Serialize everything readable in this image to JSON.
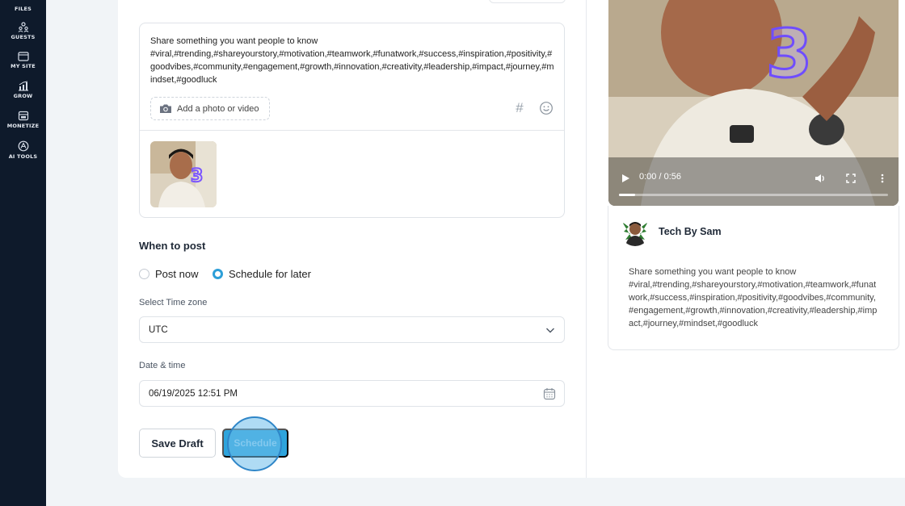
{
  "sidebar": {
    "items": [
      {
        "label": "FILES",
        "icon": "files-icon"
      },
      {
        "label": "GUESTS",
        "icon": "guests-icon"
      },
      {
        "label": "MY SITE",
        "icon": "my-site-icon"
      },
      {
        "label": "GROW",
        "icon": "grow-icon"
      },
      {
        "label": "MONETIZE",
        "icon": "monetize-icon"
      },
      {
        "label": "AI TOOLS",
        "icon": "ai-tools-icon"
      }
    ]
  },
  "composer": {
    "line1": "Share something you want people to know",
    "hashtags": "#viral,#trending,#shareyourstory,#motivation,#teamwork,#funatwork,#success,#inspiration,#positivity,#goodvibes,#community,#engagement,#growth,#innovation,#creativity,#leadership,#impact,#journey,#mindset,#goodluck",
    "add_media_label": "Add a photo or video",
    "hashtag_glyph": "#"
  },
  "schedule": {
    "title": "When to post",
    "option_now": "Post now",
    "option_later": "Schedule for later",
    "selected": "later",
    "timezone_label": "Select Time zone",
    "timezone_value": "UTC",
    "datetime_label": "Date & time",
    "datetime_value": "06/19/2025 12:51 PM"
  },
  "actions": {
    "draft_label": "Save Draft",
    "schedule_label": "Schedule"
  },
  "preview": {
    "video_time": "0:00 / 0:56",
    "video_progress": 0.06,
    "overlay_number": "3",
    "author": "Tech By Sam",
    "line1": "Share something you want people to know",
    "hashtags": "#viral,#trending,#shareyourstory,#motivation,#teamwork,#funatwork,#success,#inspiration,#positivity,#goodvibes,#community,#engagement,#growth,#innovation,#creativity,#leadership,#impact,#journey,#mindset,#goodluck"
  },
  "colors": {
    "sidebar_bg": "#0e1a2b",
    "accent": "#2ea4dc",
    "page_bg": "#f1f4f7"
  }
}
